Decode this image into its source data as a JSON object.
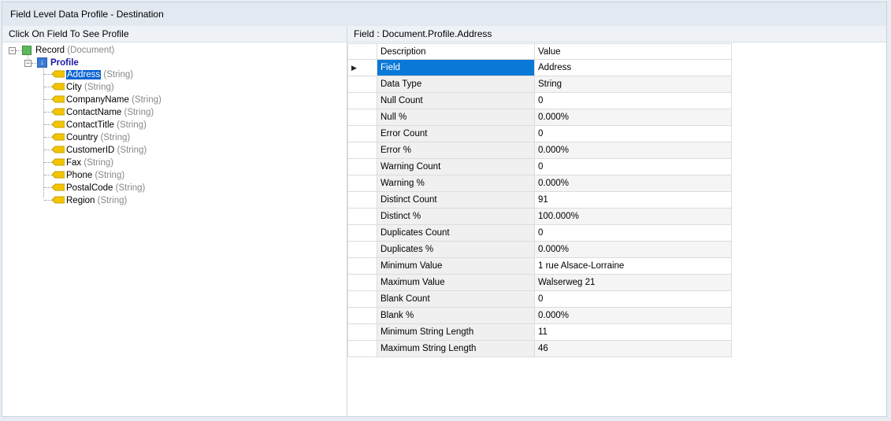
{
  "window": {
    "title": "Field Level Data Profile - Destination"
  },
  "left_pane": {
    "header": "Click On Field To See Profile",
    "tree": {
      "root": {
        "label": "Record",
        "type": "(Document)",
        "expander": "−"
      },
      "profile": {
        "label": "Profile",
        "expander": "−"
      },
      "fields": [
        {
          "label": "Address",
          "type": "(String)",
          "selected": true
        },
        {
          "label": "City",
          "type": "(String)"
        },
        {
          "label": "CompanyName",
          "type": "(String)"
        },
        {
          "label": "ContactName",
          "type": "(String)"
        },
        {
          "label": "ContactTitle",
          "type": "(String)"
        },
        {
          "label": "Country",
          "type": "(String)"
        },
        {
          "label": "CustomerID",
          "type": "(String)"
        },
        {
          "label": "Fax",
          "type": "(String)"
        },
        {
          "label": "Phone",
          "type": "(String)"
        },
        {
          "label": "PostalCode",
          "type": "(String)"
        },
        {
          "label": "Region",
          "type": "(String)"
        }
      ]
    }
  },
  "right_pane": {
    "header": "Field : Document.Profile.Address",
    "columns": {
      "description": "Description",
      "value": "Value"
    },
    "row_indicator": "▶",
    "rows": [
      {
        "description": "Field",
        "value": "Address"
      },
      {
        "description": "Data Type",
        "value": "String"
      },
      {
        "description": "Null Count",
        "value": "0"
      },
      {
        "description": "Null %",
        "value": "0.000%"
      },
      {
        "description": "Error Count",
        "value": "0"
      },
      {
        "description": "Error %",
        "value": "0.000%"
      },
      {
        "description": "Warning Count",
        "value": "0"
      },
      {
        "description": "Warning %",
        "value": "0.000%"
      },
      {
        "description": "Distinct Count",
        "value": "91"
      },
      {
        "description": "Distinct %",
        "value": "100.000%"
      },
      {
        "description": "Duplicates Count",
        "value": "0"
      },
      {
        "description": "Duplicates %",
        "value": "0.000%"
      },
      {
        "description": "Minimum Value",
        "value": "1 rue Alsace-Lorraine"
      },
      {
        "description": "Maximum Value",
        "value": "Walserweg 21"
      },
      {
        "description": "Blank Count",
        "value": "0"
      },
      {
        "description": "Blank %",
        "value": "0.000%"
      },
      {
        "description": "Minimum String Length",
        "value": "11"
      },
      {
        "description": "Maximum String Length",
        "value": "46"
      }
    ]
  },
  "colors": {
    "selection": "#0a64d2",
    "record_icon": "#5cb85c",
    "profile_icon": "#3a7bd5",
    "field_icon": "#f2c500"
  }
}
